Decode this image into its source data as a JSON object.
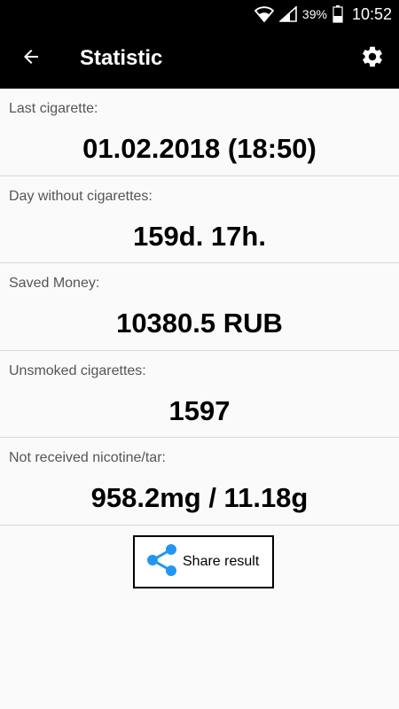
{
  "status_bar": {
    "battery_pct": "39%",
    "clock": "10:52",
    "icons": [
      "wifi-icon",
      "signal-icon",
      "battery-icon"
    ]
  },
  "app_bar": {
    "title": "Statistic",
    "back_icon": "arrow-left-icon",
    "settings_icon": "gear-icon"
  },
  "stats": [
    {
      "label": "Last cigarette:",
      "value": "01.02.2018 (18:50)"
    },
    {
      "label": "Day without cigarettes:",
      "value": "159d. 17h."
    },
    {
      "label": "Saved Money:",
      "value": "10380.5 RUB"
    },
    {
      "label": "Unsmoked cigarettes:",
      "value": "1597"
    },
    {
      "label": "Not received nicotine/tar:",
      "value": "958.2mg / 11.18g"
    }
  ],
  "share": {
    "label": "Share result",
    "icon": "share-icon",
    "icon_color": "#2196f3"
  }
}
